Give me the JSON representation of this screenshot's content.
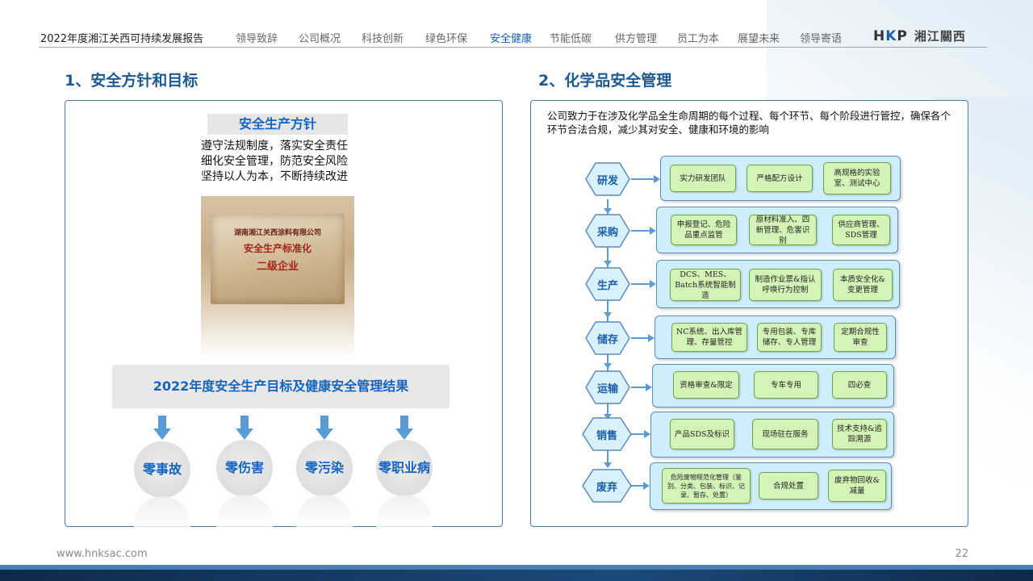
{
  "header": {
    "report_title": "2022年度湘江关西可持续发展报告",
    "nav": [
      {
        "label": "领导致辞",
        "active": false
      },
      {
        "label": "公司概况",
        "active": false
      },
      {
        "label": "科技创新",
        "active": false
      },
      {
        "label": "绿色环保",
        "active": false
      },
      {
        "label": "安全健康",
        "active": true
      },
      {
        "label": "节能低碳",
        "active": false
      },
      {
        "label": "供方管理",
        "active": false
      },
      {
        "label": "员工为本",
        "active": false
      },
      {
        "label": "展望未来",
        "active": false
      },
      {
        "label": "领导寄语",
        "active": false
      }
    ],
    "logo_mark": "HKP",
    "logo_text": "湘江關西"
  },
  "left": {
    "section_title": "1、安全方针和目标",
    "policy_tag": "安全生产方针",
    "policy_lines": [
      "遵守法规制度，落实安全责任",
      "细化安全管理，防范安全风险",
      "坚持以人为本，不断持续改进"
    ],
    "plaque_lines": [
      "湖南湘江关西涂料有限公司",
      "安全生产标准化",
      "二级企业"
    ],
    "results_title": "2022年度安全生产目标及健康安全管理结果",
    "goals": [
      "零事故",
      "零伤害",
      "零污染",
      "零职业病"
    ]
  },
  "right": {
    "section_title": "2、化学品安全管理",
    "intro": "公司致力于在涉及化学品全生命周期的每个过程、每个环节、每个阶段进行管控，确保各个环节合法合规，减少其对安全、健康和环境的影响",
    "stages": [
      {
        "label": "研发",
        "items": [
          "实力研发团队",
          "严格配方设计",
          "高规格的实验室、测试中心"
        ]
      },
      {
        "label": "采购",
        "items": [
          "申报登记、危险品重点监管",
          "原材料准入、四新管理、危害识别",
          "供应商管理、SDS管理"
        ]
      },
      {
        "label": "生产",
        "items": [
          "DCS、MES、Batch系统智能制造",
          "制造作业票&指认呼唤行为控制",
          "本质安全化&变更管理"
        ]
      },
      {
        "label": "储存",
        "items": [
          "NC系统、出入库管理、存量管控",
          "专用包装、专库储存、专人管理",
          "定期合规性审查"
        ]
      },
      {
        "label": "运输",
        "items": [
          "资格审查&限定",
          "专车专用",
          "四必查"
        ]
      },
      {
        "label": "销售",
        "items": [
          "产品SDS及标识",
          "现场驻在服务",
          "技术支持&追踪溯源"
        ]
      },
      {
        "label": "废弃",
        "items": [
          "危险废物规范化管理（鉴别、分类、包装、标识、记录、暂存、处置）",
          "合规处置",
          "废弃物回收&减量"
        ]
      }
    ]
  },
  "footer": {
    "url": "www.hnksac.com",
    "page": "22"
  }
}
